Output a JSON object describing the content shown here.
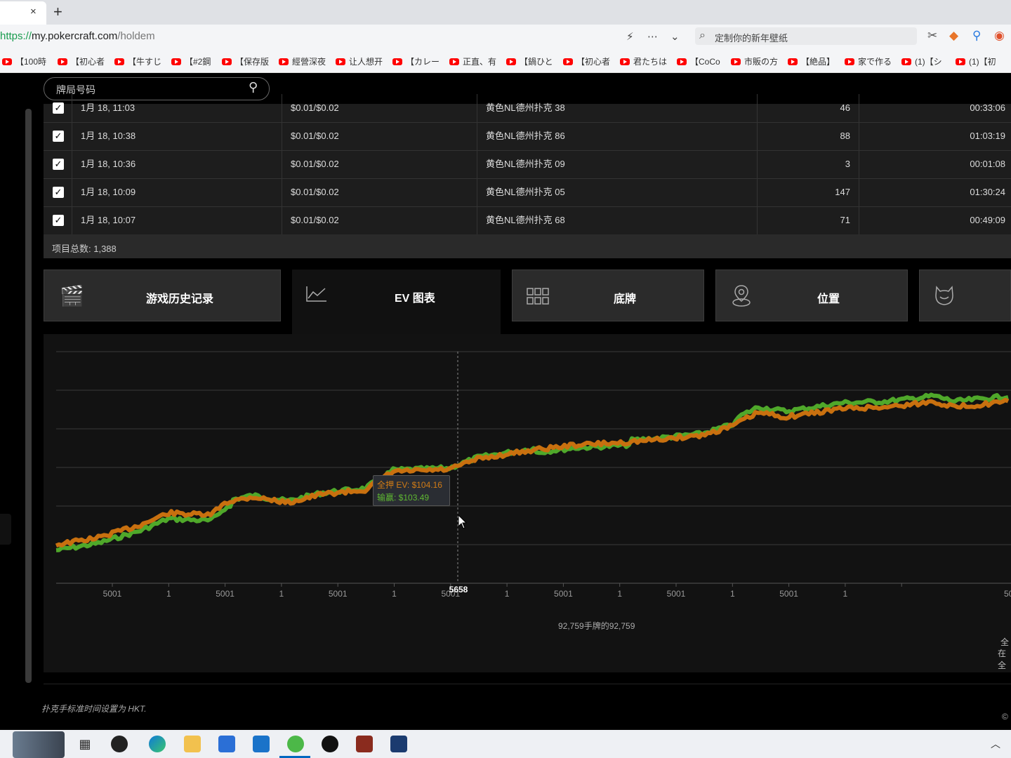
{
  "browser": {
    "new_tab": "+",
    "tab_close": "×",
    "url_scheme": "https://",
    "url_host": "my.pokercraft.com",
    "url_path": "/holdem",
    "search_placeholder": "定制你的新年壁纸",
    "bookmarks": [
      "【100時",
      "【初心者",
      "【牛すじ",
      "【#2鋼",
      "【保存版",
      "經營深夜",
      "让人想开",
      "【カレー",
      "正直、有",
      "【鍋ひと",
      "【初心者",
      "君たちは",
      "【CoCo",
      "市販の方",
      "【絶品】",
      "家で作る",
      "(1)【シ",
      "(1)【初"
    ]
  },
  "hand_search": {
    "placeholder": "牌局号码"
  },
  "table": {
    "rows": [
      {
        "checked": true,
        "date": "1月 18, 11:03",
        "stakes": "$0.01/$0.02",
        "table": "黄色NL德州扑克 38",
        "hands": "46",
        "duration": "00:33:06"
      },
      {
        "checked": true,
        "date": "1月 18, 10:38",
        "stakes": "$0.01/$0.02",
        "table": "黄色NL德州扑克 86",
        "hands": "88",
        "duration": "01:03:19"
      },
      {
        "checked": true,
        "date": "1月 18, 10:36",
        "stakes": "$0.01/$0.02",
        "table": "黄色NL德州扑克 09",
        "hands": "3",
        "duration": "00:01:08"
      },
      {
        "checked": true,
        "date": "1月 18, 10:09",
        "stakes": "$0.01/$0.02",
        "table": "黄色NL德州扑克 05",
        "hands": "147",
        "duration": "01:30:24"
      },
      {
        "checked": true,
        "date": "1月 18, 10:07",
        "stakes": "$0.01/$0.02",
        "table": "黄色NL德州扑克 68",
        "hands": "71",
        "duration": "00:49:09"
      }
    ],
    "total_label": "项目总数: 1,388"
  },
  "tabs": {
    "history": "游戏历史记录",
    "ev": "EV 图表",
    "showdown": "底牌",
    "position": "位置"
  },
  "chart_data": {
    "type": "line",
    "x_tick_labels": [
      "5001",
      "1",
      "5001",
      "1",
      "5001",
      "1",
      "5001",
      "1",
      "5001",
      "1",
      "5001",
      "1",
      "5001",
      "1",
      "50"
    ],
    "hover_x_label": "5658",
    "series": [
      {
        "name": "全押 EV",
        "color": "#c8700f"
      },
      {
        "name": "输赢",
        "color": "#4fa82a"
      }
    ],
    "tooltip": {
      "ev_label": "全押 EV: $104.16",
      "won_label": "输赢: $103.49"
    },
    "grid": true,
    "caption": "92,759手牌的92,759",
    "side_label_1": "全",
    "side_label_2": "在全"
  },
  "footer": {
    "timezone_note": "扑克手标准时间设置为 HKT.",
    "copyright": "©"
  }
}
